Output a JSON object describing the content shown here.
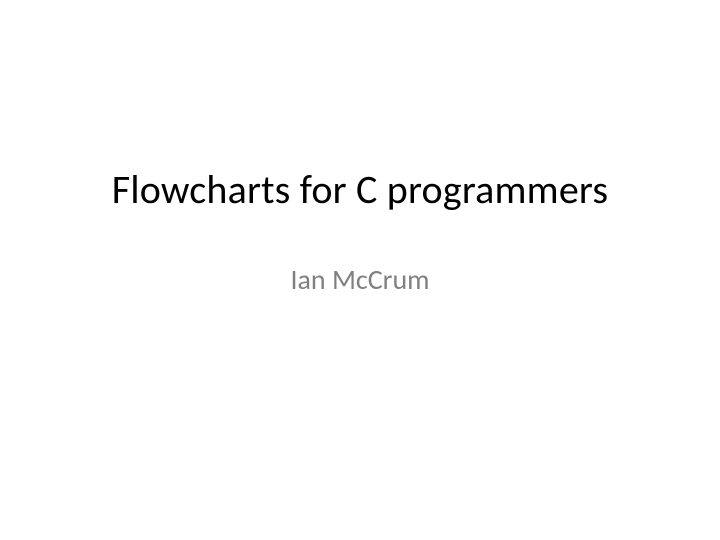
{
  "slide": {
    "title": "Flowcharts for C programmers",
    "subtitle": "Ian McCrum"
  }
}
